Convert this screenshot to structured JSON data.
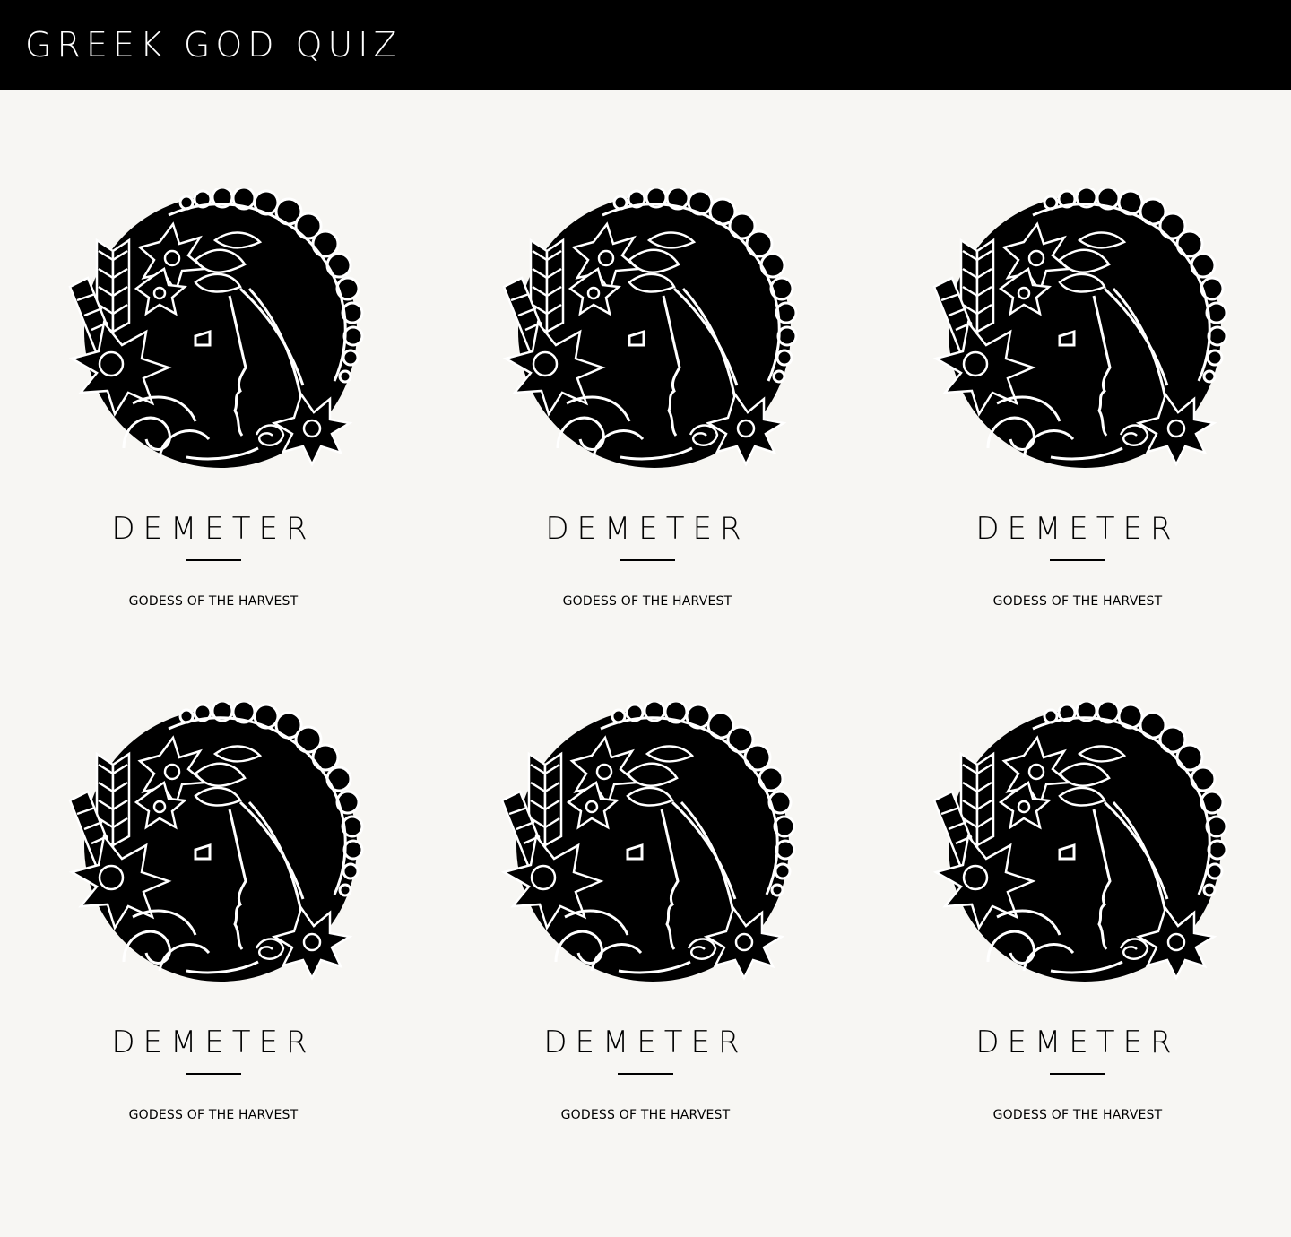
{
  "header": {
    "title": "GREEK GOD QUIZ"
  },
  "colors": {
    "header_bg": "#000000",
    "page_bg": "#f7f6f3",
    "ink": "#000000"
  },
  "cards": [
    {
      "name": "DEMETER",
      "title": "GODESS OF THE HARVEST",
      "icon": "demeter-emblem-icon"
    },
    {
      "name": "DEMETER",
      "title": "GODESS OF THE HARVEST",
      "icon": "demeter-emblem-icon"
    },
    {
      "name": "DEMETER",
      "title": "GODESS OF THE HARVEST",
      "icon": "demeter-emblem-icon"
    },
    {
      "name": "DEMETER",
      "title": "GODESS OF THE HARVEST",
      "icon": "demeter-emblem-icon"
    },
    {
      "name": "DEMETER",
      "title": "GODESS OF THE HARVEST",
      "icon": "demeter-emblem-icon"
    },
    {
      "name": "DEMETER",
      "title": "GODESS OF THE HARVEST",
      "icon": "demeter-emblem-icon"
    }
  ]
}
